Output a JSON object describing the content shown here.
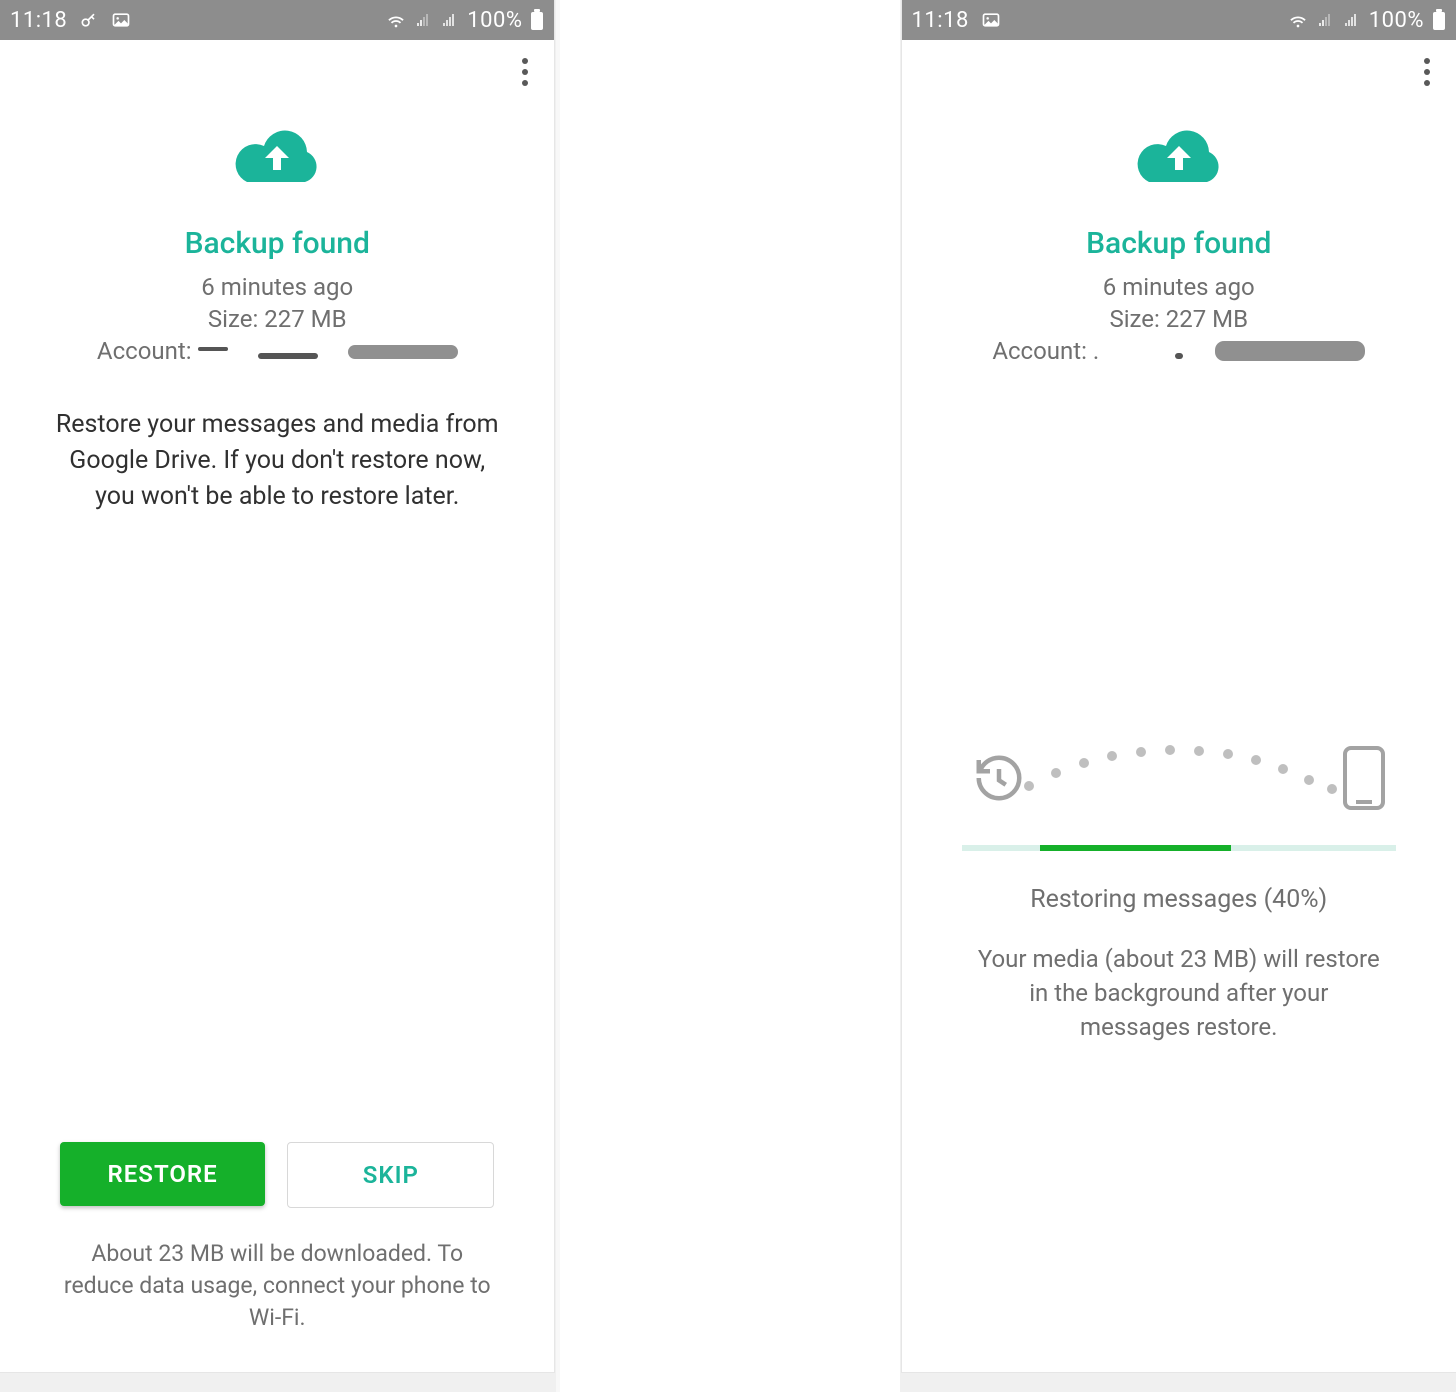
{
  "statusbar": {
    "time": "11:18",
    "batteryText": "100%"
  },
  "screenLeft": {
    "title": "Backup found",
    "timeAgo": "6 minutes ago",
    "size": "Size: 227 MB",
    "accountLabel": "Account:",
    "description": "Restore your messages and media from Google Drive. If you don't restore now, you won't be able to restore later.",
    "restoreLabel": "RESTORE",
    "skipLabel": "SKIP",
    "footnote": "About 23 MB will be downloaded. To reduce data usage, connect your phone to Wi-Fi."
  },
  "screenRight": {
    "title": "Backup found",
    "timeAgo": "6 minutes ago",
    "size": "Size: 227 MB",
    "accountLabel": "Account: .",
    "progressPercent": 40,
    "progressBarStart": 18,
    "progressBarWidth": 44,
    "statusText": "Restoring messages (40%)",
    "statusSub": "Your media (about 23 MB) will restore in the background after your messages restore."
  },
  "colors": {
    "accent": "#1bb49a",
    "primaryButton": "#15b02a",
    "statusbar": "#8d8d8d",
    "textMuted": "#6f6f6f"
  }
}
